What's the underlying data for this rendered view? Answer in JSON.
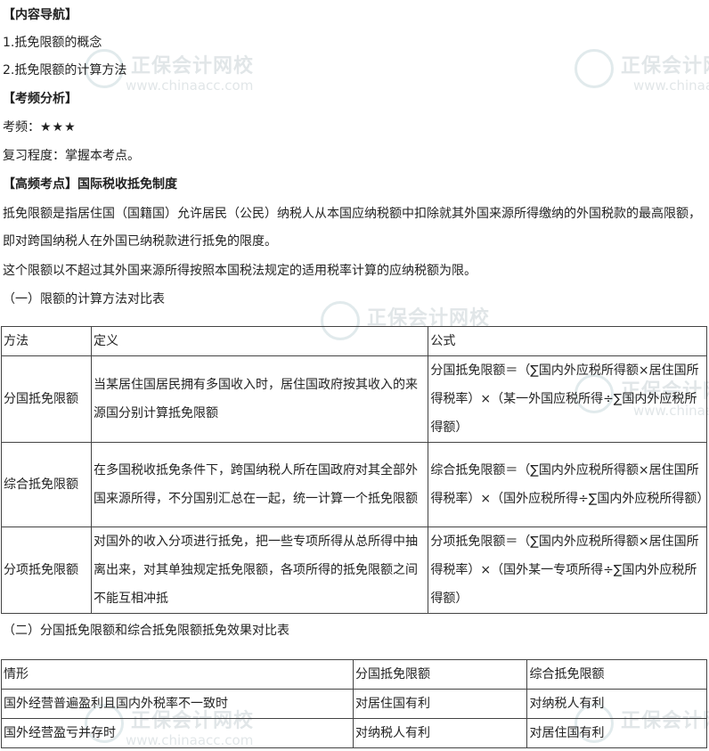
{
  "watermark": {
    "text": "正保会计网校",
    "url": "www.chinaacc.com"
  },
  "sections": {
    "nav_title": "【内容导航】",
    "nav_items": [
      "1.抵免限额的概念",
      "2.抵免限额的计算方法"
    ],
    "freq_title": "【考频分析】",
    "freq_label": "考频：",
    "freq_stars": "★★★",
    "review_text": "复习程度：掌握本考点。",
    "key_bracket": "【高频考点】",
    "key_title": "国际税收抵免制度",
    "para1": "抵免限额是指居住国（国籍国）允许居民（公民）纳税人从本国应纳税额中扣除就其外国来源所得缴纳的外国税款的最高限额，即对跨国纳税人在外国已纳税款进行抵免的限度。",
    "para2": "这个限额以不超过其外国来源所得按照本国税法规定的适用税率计算的应纳税额为限。",
    "table1_caption": "（一）限额的计算方法对比表",
    "table2_caption": "（二）分国抵免限额和综合抵免限额抵免效果对比表"
  },
  "table1": {
    "headers": [
      "方法",
      "定义",
      "公式"
    ],
    "rows": [
      [
        "分国抵免限额",
        "当某居住国居民拥有多国收入时，居住国政府按其收入的来源国分别计算抵免限额",
        "分国抵免限额＝（∑国内外应税所得额×居住国所得税率）×（某一外国应税所得÷∑国内外应税所得额）"
      ],
      [
        "综合抵免限额",
        "在多国税收抵免条件下，跨国纳税人所在国政府对其全部外国来源所得，不分国别汇总在一起，统一计算一个抵免限额",
        "综合抵免限额＝（∑国内外应税所得额×居住国所得税率）×（国外应税所得÷∑国内外应税所得额）"
      ],
      [
        "分项抵免限额",
        "对国外的收入分项进行抵免，把一些专项所得从总所得中抽离出来，对其单独规定抵免限额，各项所得的抵免限额之间不能互相冲抵",
        "分项抵免限额＝（∑国内外应税所得额×居住国所得税率）×（国外某一专项所得÷∑国内外应税所得额）"
      ]
    ]
  },
  "table2": {
    "headers": [
      "情形",
      "分国抵免限额",
      "综合抵免限额"
    ],
    "rows": [
      [
        "国外经营普遍盈利且国内外税率不一致时",
        "对居住国有利",
        "对纳税人有利"
      ],
      [
        "国外经营盈亏并存时",
        "对纳税人有利",
        "对居住国有利"
      ]
    ]
  }
}
